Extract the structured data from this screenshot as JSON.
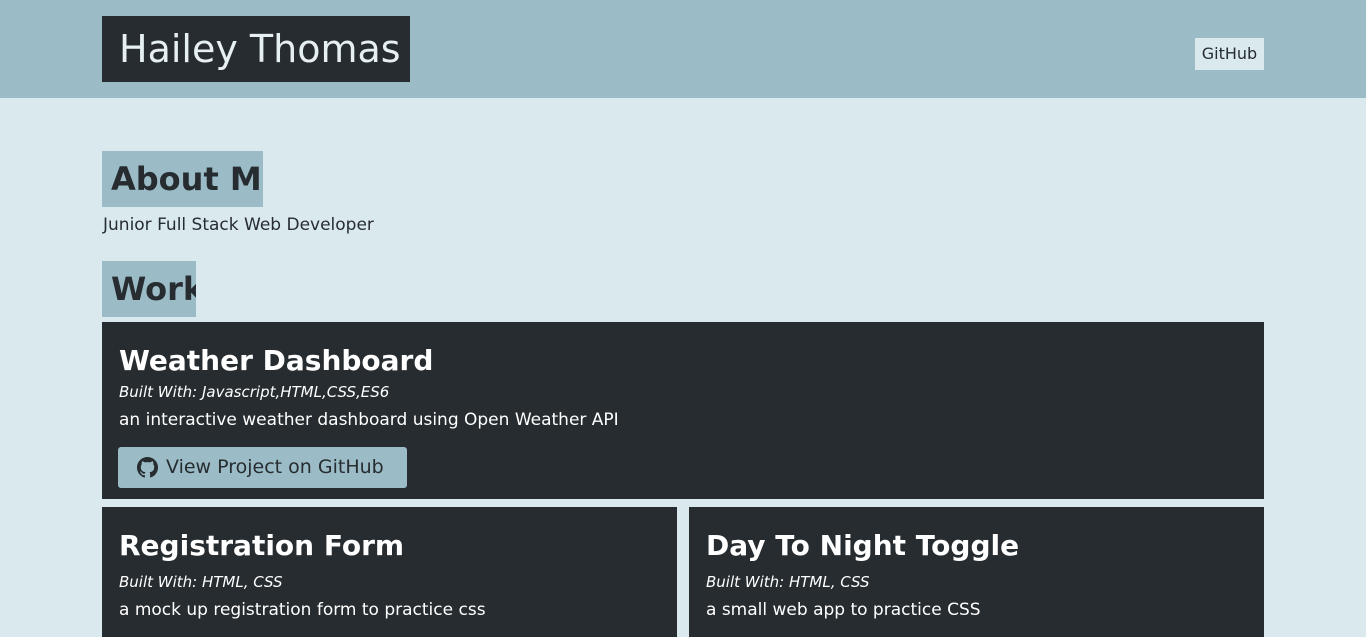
{
  "header": {
    "brand": "Hailey Thomas",
    "nav_link": "GitHub"
  },
  "about": {
    "heading": "About Me",
    "text": "Junior Full Stack Web Developer"
  },
  "work": {
    "heading": "Work",
    "projects": [
      {
        "title": "Weather Dashboard",
        "built_with": "Built With: Javascript,HTML,CSS,ES6",
        "description": "an interactive weather dashboard using Open Weather API",
        "button_label": "View Project on GitHub",
        "button_icon": "github-icon"
      },
      {
        "title": "Registration Form",
        "built_with": "Built With: HTML, CSS",
        "description": "a mock up registration form to practice css"
      },
      {
        "title": "Day To Night Toggle",
        "built_with": "Built With: HTML, CSS",
        "description": "a small web app to practice CSS"
      }
    ]
  },
  "colors": {
    "page_bg": "#dae9ee",
    "header_bg": "#9bbcc6",
    "dark": "#262c30",
    "accent": "#9bbcc6"
  }
}
